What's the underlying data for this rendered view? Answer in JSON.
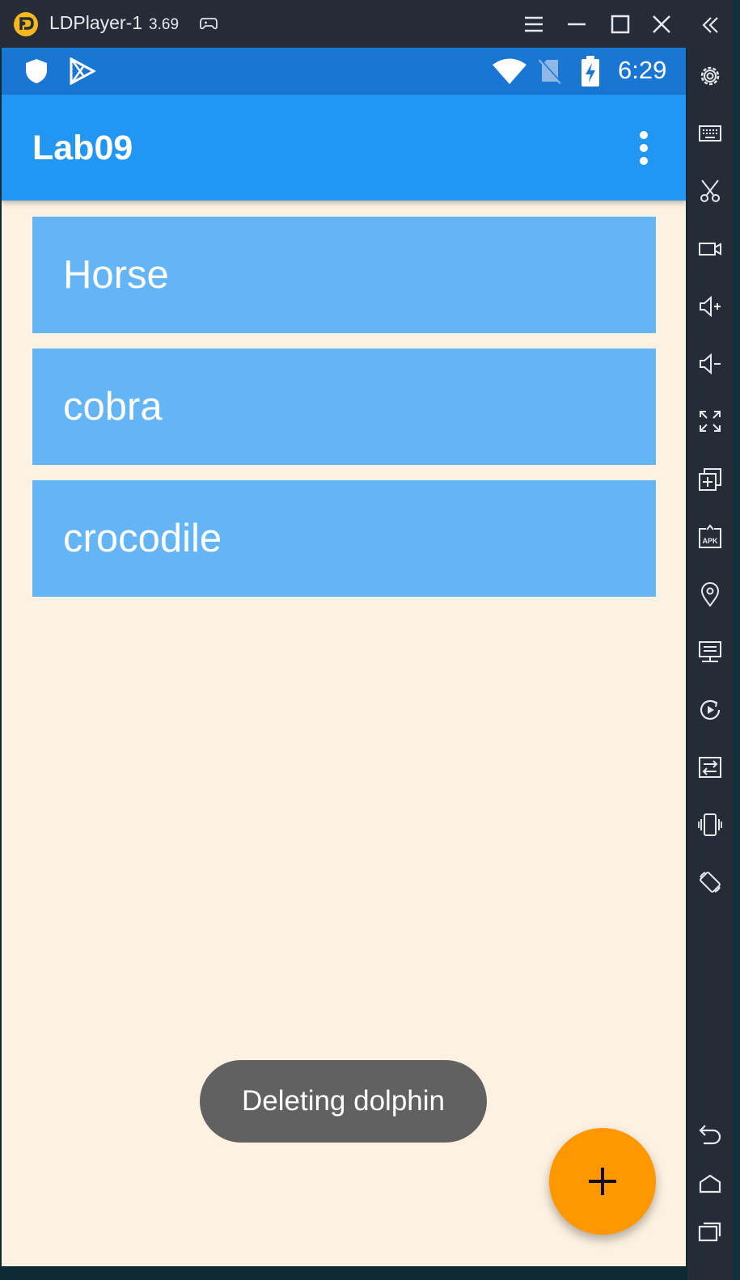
{
  "window": {
    "app_name": "LDPlayer-1",
    "version": "3.69"
  },
  "status_bar": {
    "time": "6:29"
  },
  "app_bar": {
    "title": "Lab09"
  },
  "list": {
    "items": [
      {
        "label": "Horse"
      },
      {
        "label": "cobra"
      },
      {
        "label": "crocodile"
      }
    ]
  },
  "toast": {
    "message": "Deleting dolphin"
  },
  "colors": {
    "status_bar": "#1976d2",
    "app_bar": "#2196f3",
    "list_item": "#64b5f6",
    "background": "#fdf1e1",
    "fab": "#ff9800",
    "toast": "#616161",
    "emulator_chrome": "#252b37"
  },
  "icons": {
    "title_bar": [
      "ldplayer-logo-icon",
      "gamepad-icon",
      "menu-icon",
      "minimize-icon",
      "maximize-icon",
      "close-icon"
    ],
    "sidebar": [
      "collapse-icon",
      "settings-icon",
      "keyboard-icon",
      "scissors-icon",
      "video-record-icon",
      "volume-up-icon",
      "volume-down-icon",
      "fullscreen-icon",
      "multi-instance-icon",
      "apk-install-icon",
      "location-icon",
      "remote-desktop-icon",
      "operation-record-icon",
      "sync-icon",
      "shake-icon",
      "rotate-icon",
      "back-icon",
      "home-icon",
      "recent-apps-icon"
    ],
    "status_bar": [
      "shield-icon",
      "play-store-icon",
      "wifi-icon",
      "no-sim-icon",
      "battery-charging-icon"
    ],
    "app": [
      "overflow-menu-icon",
      "add-icon"
    ]
  }
}
